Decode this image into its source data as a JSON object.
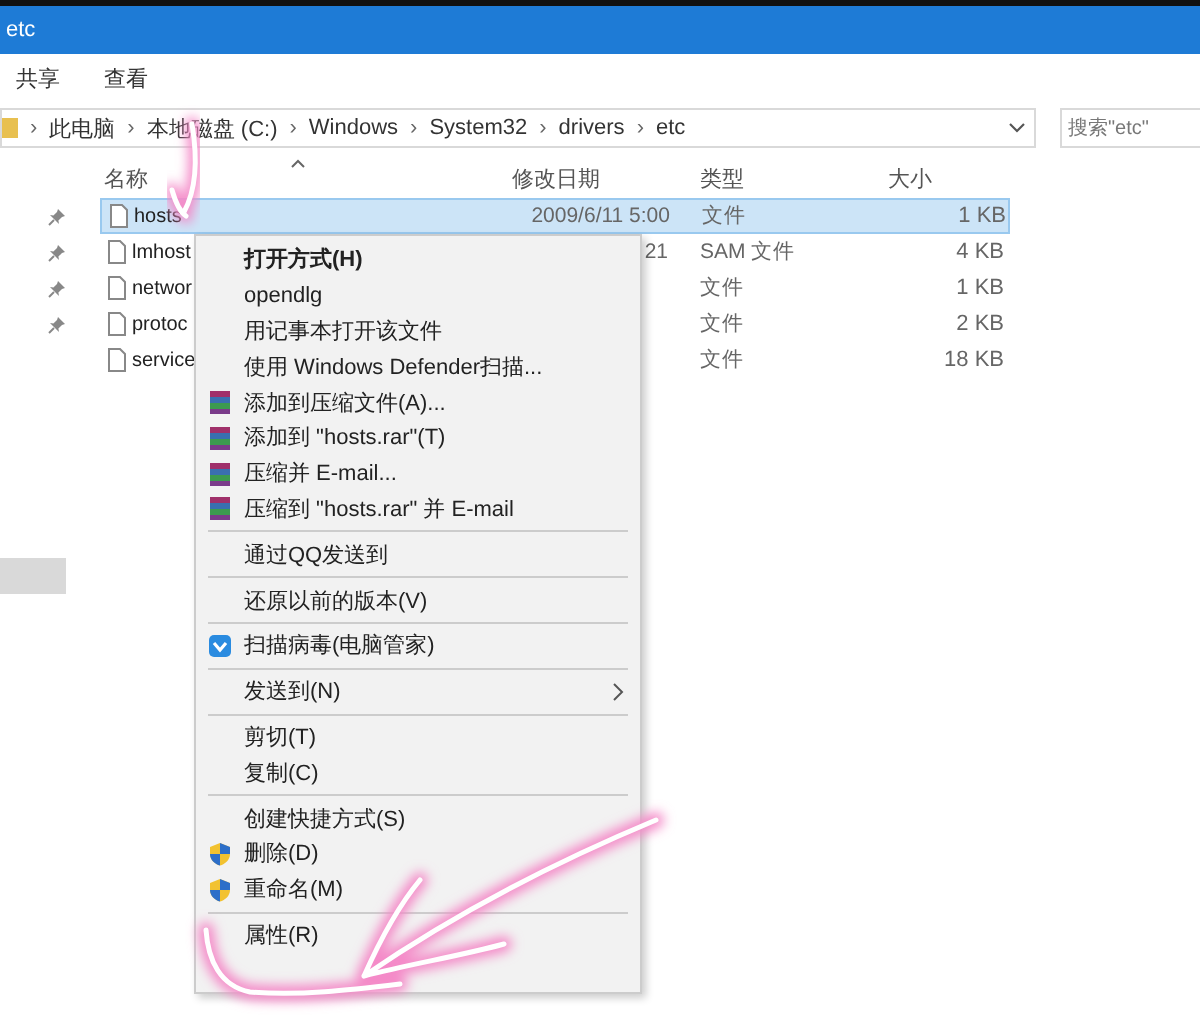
{
  "window": {
    "title": "etc"
  },
  "ribbon_tabs": [
    "共享",
    "查看"
  ],
  "address_bar": {
    "path": [
      "此电脑",
      "本地磁盘 (C:)",
      "Windows",
      "System32",
      "drivers",
      "etc"
    ],
    "separator": "›"
  },
  "search": {
    "placeholder": "搜索\"etc\""
  },
  "columns": [
    "名称",
    "修改日期",
    "类型",
    "大小"
  ],
  "nav_pane": {
    "items": [
      {
        "pinned": true,
        "selected": false
      },
      {
        "pinned": true,
        "selected": false
      },
      {
        "pinned": true,
        "selected": false
      },
      {
        "pinned": true,
        "selected": false
      },
      {
        "pinned": false,
        "selected": false
      },
      {
        "pinned": false,
        "selected": false
      },
      {
        "pinned": false,
        "selected": false
      },
      {
        "pinned": false,
        "selected": false
      },
      {
        "pinned": false,
        "selected": false
      },
      {
        "pinned": false,
        "selected": false
      },
      {
        "pinned": false,
        "selected": true
      }
    ]
  },
  "files": [
    {
      "name": "hosts",
      "date": "2009/6/11 5:00",
      "type": "文件",
      "size": "1 KB",
      "selected": true
    },
    {
      "name": "lmhost",
      "date": "21",
      "type": "SAM 文件",
      "size": "4 KB",
      "selected": false
    },
    {
      "name": "networ",
      "type": "文件",
      "size": "1 KB",
      "selected": false
    },
    {
      "name": "protoc",
      "type": "文件",
      "size": "2 KB",
      "selected": false
    },
    {
      "name": "service",
      "type": "文件",
      "size": "18 KB",
      "selected": false
    }
  ],
  "context_menu": {
    "groups": [
      [
        {
          "label": "打开方式(H)",
          "kind": "default"
        },
        {
          "label": "opendlg",
          "kind": "plain"
        },
        {
          "label": "用记事本打开该文件",
          "kind": "plain"
        },
        {
          "label": "使用 Windows Defender扫描...",
          "kind": "plain"
        },
        {
          "label": "添加到压缩文件(A)...",
          "kind": "archive"
        },
        {
          "label": "添加到 \"hosts.rar\"(T)",
          "kind": "archive"
        },
        {
          "label": "压缩并 E-mail...",
          "kind": "archive"
        },
        {
          "label": "压缩到 \"hosts.rar\" 并 E-mail",
          "kind": "archive"
        }
      ],
      [
        {
          "label": "通过QQ发送到",
          "kind": "plain"
        }
      ],
      [
        {
          "label": "还原以前的版本(V)",
          "kind": "plain"
        }
      ],
      [
        {
          "label": "扫描病毒(电脑管家)",
          "kind": "antivirus"
        }
      ],
      [
        {
          "label": "发送到(N)",
          "kind": "submenu"
        }
      ],
      [
        {
          "label": "剪切(T)",
          "kind": "plain"
        },
        {
          "label": "复制(C)",
          "kind": "plain"
        }
      ],
      [
        {
          "label": "创建快捷方式(S)",
          "kind": "plain"
        },
        {
          "label": "删除(D)",
          "kind": "protected"
        },
        {
          "label": "重命名(M)",
          "kind": "protected"
        }
      ],
      [
        {
          "label": "属性(R)",
          "kind": "plain"
        }
      ]
    ]
  }
}
